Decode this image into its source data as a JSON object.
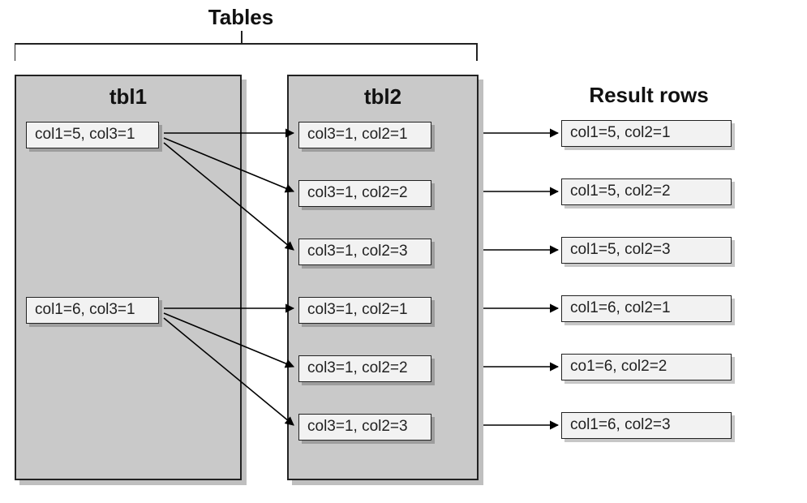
{
  "title": "Tables",
  "result_title": "Result rows",
  "tbl1": {
    "title": "tbl1",
    "rows": [
      "col1=5, col3=1",
      "col1=6, col3=1"
    ]
  },
  "tbl2": {
    "title": "tbl2",
    "rows": [
      "col3=1, col2=1",
      "col3=1, col2=2",
      "col3=1, col2=3",
      "col3=1, col2=1",
      "col3=1, col2=2",
      "col3=1, col2=3"
    ]
  },
  "result": {
    "rows": [
      "col1=5, col2=1",
      "col1=5, col2=2",
      "col1=5, col2=3",
      "col1=6, col2=1",
      "co1=6, col2=2",
      "col1=6, col2=3"
    ]
  }
}
